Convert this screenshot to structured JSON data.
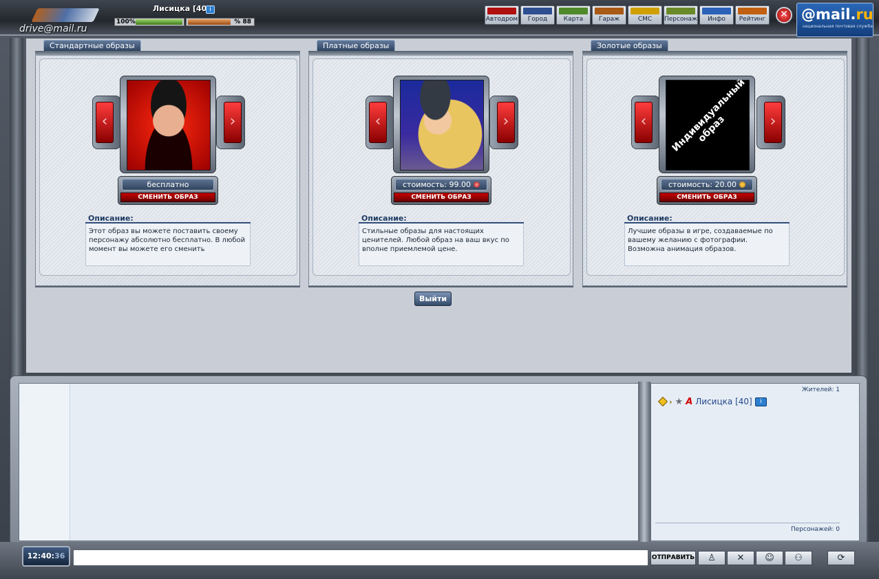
{
  "header": {
    "brand": "drive@mail.ru",
    "player_name": "Лисицка [40]",
    "info_icon": "i",
    "hp_label": "100",
    "hp_percent_label": "%",
    "energy_label": "88",
    "energy_percent_label": "%",
    "hp_level": 1.0,
    "energy_level": 0.88,
    "nav": [
      {
        "label": "Автодром",
        "icon": "checkered-flag-icon",
        "color": "#b01010"
      },
      {
        "label": "Город",
        "icon": "city-icon",
        "color": "#2d4f91"
      },
      {
        "label": "Карта",
        "icon": "map-icon",
        "color": "#4f8a2a"
      },
      {
        "label": "Гараж",
        "icon": "garage-icon",
        "color": "#a85a16"
      },
      {
        "label": "СМС",
        "icon": "sms-icon",
        "color": "#d0a000"
      },
      {
        "label": "Персонаж",
        "icon": "character-icon",
        "color": "#6a8a2a"
      },
      {
        "label": "Инфо",
        "icon": "info-icon",
        "color": "#2a62b8"
      },
      {
        "label": "Рейтинг",
        "icon": "rating-icon",
        "color": "#c06010"
      }
    ],
    "close_icon": "✕",
    "mail_logo": "@mail.ru",
    "mail_logo_sub": "национальная почтовая служба"
  },
  "panels": [
    {
      "tab": "Стандартные образы",
      "portrait_icon": "portrait-dark-hair-woman",
      "cost_label": "бесплатно",
      "cost_coin": "",
      "change_label": "СМЕНИТЬ ОБРАЗ",
      "desc_title": "Описание:",
      "desc_text": "Этот образ вы можете поставить своему персонажу абсолютно бесплатно. В любой момент вы можете его сменить"
    },
    {
      "tab": "Платные образы",
      "portrait_icon": "portrait-blonde-woman-beret",
      "cost_label": "стоимость: 99.00",
      "cost_coin": "red",
      "change_label": "СМЕНИТЬ ОБРАЗ",
      "desc_title": "Описание:",
      "desc_text": "Стильные образы для настоящих ценителей. Любой образ на ваш вкус по вполне приемлемой цене."
    },
    {
      "tab": "Золотые образы",
      "portrait_icon": "custom-portrait-placeholder",
      "portrait_text": "Индивидуальный образ",
      "cost_label": "стоимость: 20.00",
      "cost_coin": "gold",
      "change_label": "СМЕНИТЬ ОБРАЗ",
      "desc_title": "Описание:",
      "desc_text": "Лучшие образы в игре, создаваемые по вашему желанию с фотографии. Возможна анимация образов."
    }
  ],
  "exit_label": "Выйти",
  "users": {
    "residents_label": "Жителей: 1",
    "list": [
      {
        "clan_mark": "A",
        "name": "Лисицка [40]",
        "info": "i"
      }
    ],
    "characters_label": "Персонажей: 0"
  },
  "footer": {
    "clock_hm": "12:40:",
    "clock_s": "36",
    "send_label": "ОТПРАВИТЬ",
    "buttons": [
      {
        "name": "private-message-icon",
        "glyph": "♙"
      },
      {
        "name": "clear-icon",
        "glyph": "✕"
      },
      {
        "name": "smiley-icon",
        "glyph": "☺"
      },
      {
        "name": "group-icon",
        "glyph": "⚇"
      },
      {
        "name": "refresh-icon",
        "glyph": "⟳"
      }
    ]
  },
  "colors": {
    "accent_red": "#c70000",
    "panel_blue": "#31445e",
    "link_blue": "#24488a"
  }
}
